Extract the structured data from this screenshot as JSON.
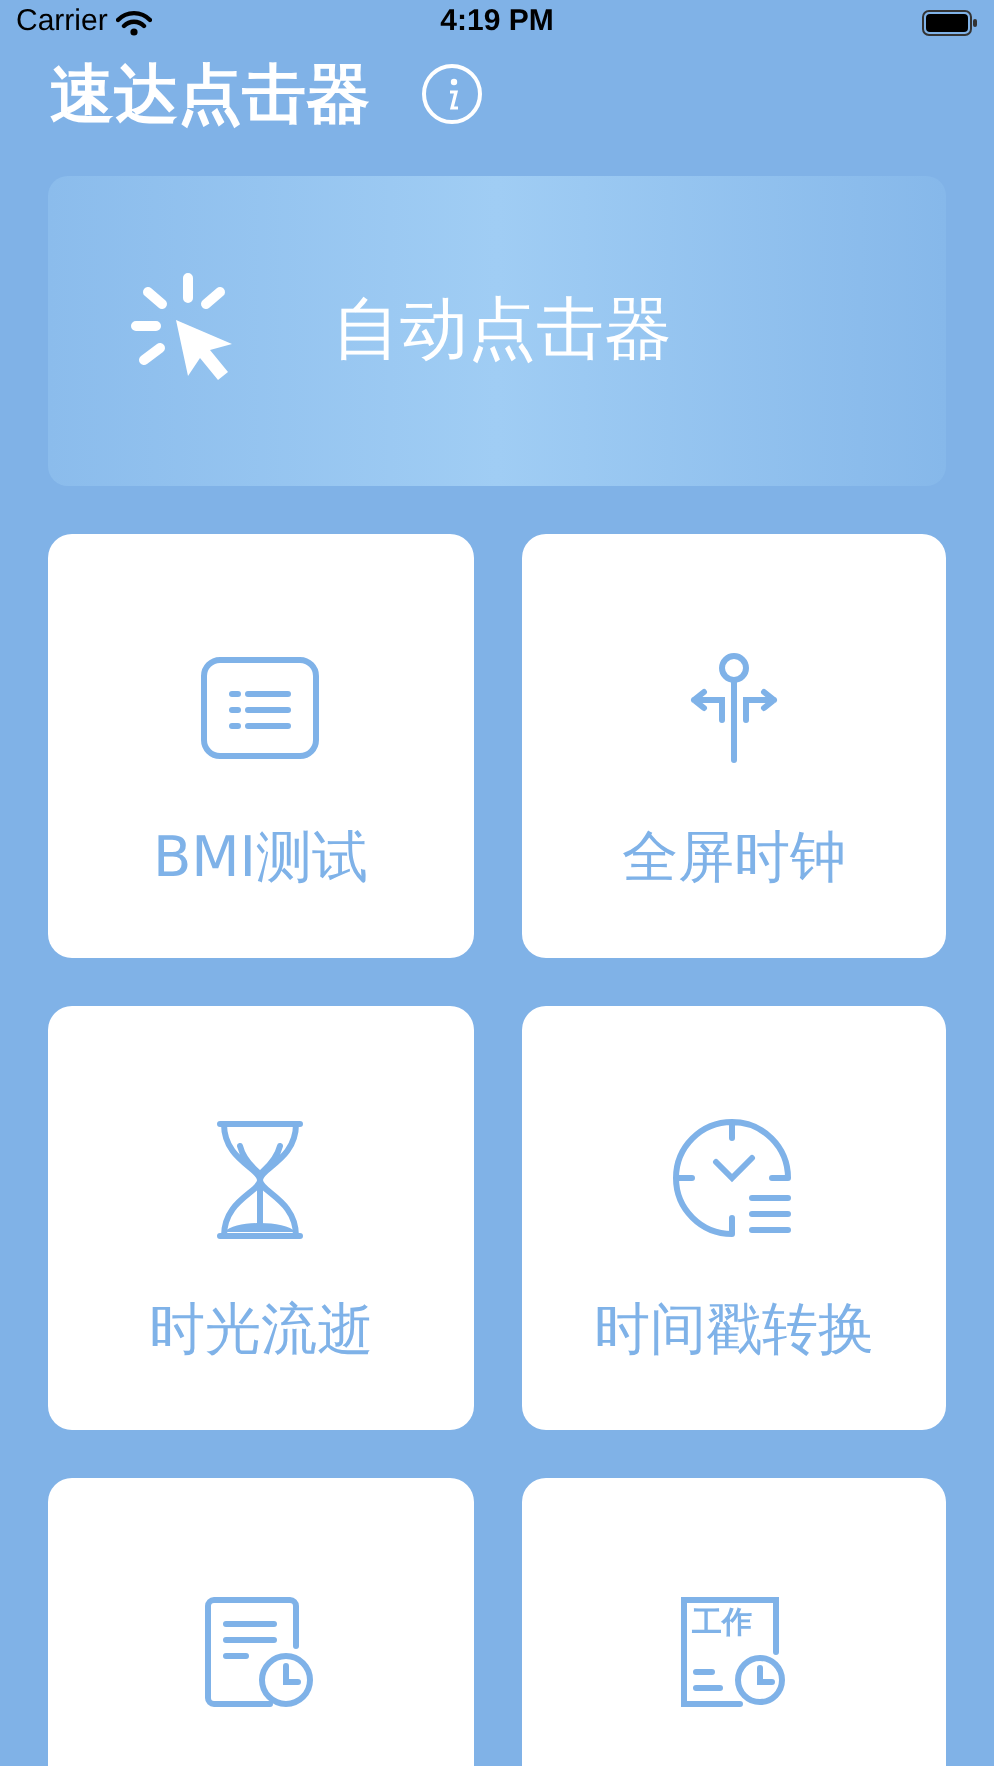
{
  "status_bar": {
    "carrier": "Carrier",
    "time": "4:19 PM"
  },
  "header": {
    "title": "速达点击器"
  },
  "banner": {
    "label": "自动点击器"
  },
  "cards": [
    {
      "kind": "list",
      "label": "BMI测试"
    },
    {
      "kind": "signpost",
      "label": "全屏时钟"
    },
    {
      "kind": "hourglass",
      "label": "时光流逝"
    },
    {
      "kind": "clocklist",
      "label": "时间戳转换"
    },
    {
      "kind": "doc-clock"
    },
    {
      "kind": "work-doc",
      "icon_text": "工作"
    }
  ]
}
